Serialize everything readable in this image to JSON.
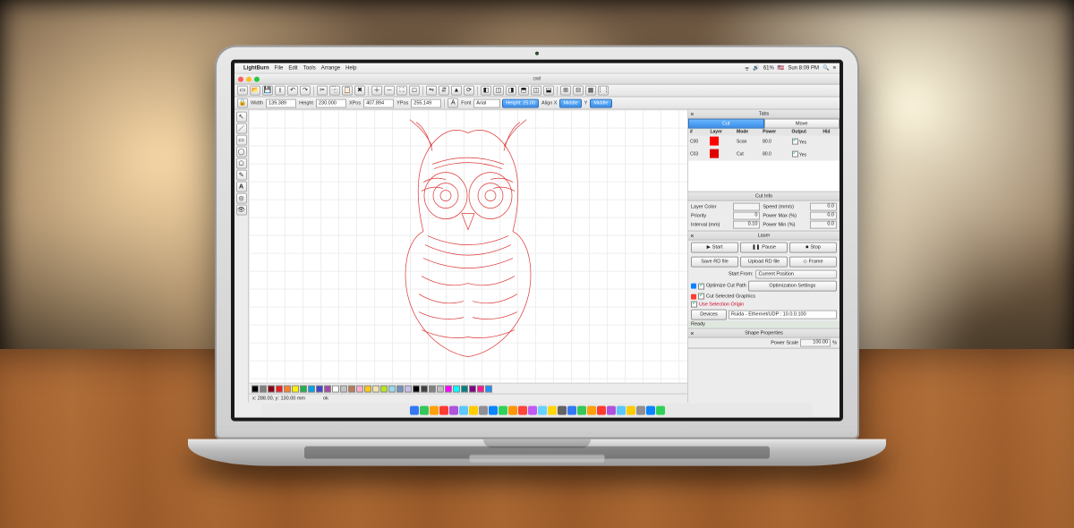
{
  "mac_menubar": {
    "app": "LightBurn",
    "items": [
      "File",
      "Edit",
      "Tools",
      "Arrange",
      "Help"
    ],
    "right": {
      "battery": "61%",
      "clock": "Sun 8:09 PM"
    }
  },
  "window": {
    "title": "owl"
  },
  "toolbar2": {
    "width_label": "Width",
    "width": "139.389",
    "height_label": "Height",
    "height": "230.000",
    "xpos_label": "XPos",
    "xpos": "407.894",
    "ypos_label": "YPos",
    "ypos": "255.149",
    "font_label": "Font",
    "font": "Arial",
    "text_height_label": "Height",
    "text_height": "25.00",
    "alignx_label": "Align X",
    "alignx": "Middle",
    "aligny_label": "Y",
    "aligny": "Middle"
  },
  "tabs_panel": {
    "title": "Tabs",
    "cut": "Cut",
    "move": "Move"
  },
  "cut_table": {
    "headers": [
      "#",
      "Layer",
      "Mode",
      "Power",
      "Output",
      "Hid"
    ],
    "rows": [
      {
        "id": "C00",
        "color": "#ff0000",
        "mode": "Scan",
        "power": "80.0",
        "output": "Yes"
      },
      {
        "id": "C03",
        "color": "#e00000",
        "mode": "Cut",
        "power": "80.0",
        "output": "Yes"
      }
    ]
  },
  "cut_info": {
    "title": "Cut Info",
    "layer_color_label": "Layer Color",
    "speed_label": "Speed (mm/s)",
    "speed": "0.0",
    "priority_label": "Priority",
    "priority": "0",
    "power_max_label": "Power Max (%)",
    "power_max": "0.0",
    "interval_label": "Interval (mm)",
    "interval": "0.10",
    "power_min_label": "Power Min (%)",
    "power_min": "0.0"
  },
  "laser": {
    "title": "Laser",
    "start": "Start",
    "pause": "Pause",
    "stop": "Stop",
    "save_rd": "Save RD file",
    "upload_rd": "Upload RD file",
    "frame": "Frame",
    "start_from_label": "Start From:",
    "start_from": "Current Position",
    "optimize_cut": "Optimize Cut Path",
    "opt_settings": "Optimization Settings",
    "cut_selected": "Cut Selected Graphics",
    "use_sel_origin": "Use Selection Origin",
    "devices_label": "Devices",
    "device": "Ruida - Ethernet/UDP : 10.0.0.100",
    "ready": "Ready"
  },
  "shape_props": {
    "title": "Shape Properties",
    "power_scale_label": "Power Scale",
    "power_scale": "100.00",
    "unit": "%"
  },
  "status": {
    "coords": "x: 288.00, y: 130.00 mm",
    "msg": "ok"
  },
  "palette": [
    "#000000",
    "#7f7f7f",
    "#880015",
    "#ed1c24",
    "#ff7f27",
    "#fff200",
    "#22b14c",
    "#00a2e8",
    "#3f48cc",
    "#a349a4",
    "#ffffff",
    "#c3c3c3",
    "#b97a57",
    "#ffaec9",
    "#ffc90e",
    "#efe4b0",
    "#b5e61d",
    "#99d9ea",
    "#7092be",
    "#c8bfe7",
    "#000000",
    "#404040",
    "#808080",
    "#c0c0c0",
    "#ff00ff",
    "#00ffff",
    "#008080",
    "#800080",
    "#ff1493",
    "#1e90ff"
  ],
  "dock_colors": [
    "#3478f6",
    "#34c759",
    "#ff9f0a",
    "#ff3b30",
    "#af52de",
    "#5ac8fa",
    "#ffcc00",
    "#8e8e93",
    "#0a84ff",
    "#30d158",
    "#ff9500",
    "#ff453a",
    "#bf5af2",
    "#64d2ff",
    "#ffd60a",
    "#636366",
    "#3478f6",
    "#34c759",
    "#ff9f0a",
    "#ff3b30",
    "#af52de",
    "#5ac8fa",
    "#ffcc00",
    "#8e8e93",
    "#0a84ff",
    "#30d158"
  ]
}
